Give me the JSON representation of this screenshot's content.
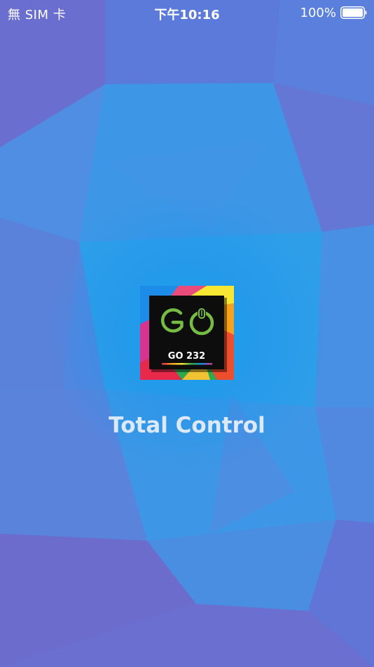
{
  "status_bar": {
    "carrier": "無 SIM 卡",
    "time": "下午10:16",
    "battery_percent": "100%",
    "battery_level": 1.0
  },
  "logo": {
    "mark_text": "GO",
    "model_label": "GO 232"
  },
  "app": {
    "title": "Total Control"
  },
  "colors": {
    "logo_green": "#76bc43",
    "logo_panel": "#0d0d0d",
    "title_text": "#dbe9fb"
  }
}
